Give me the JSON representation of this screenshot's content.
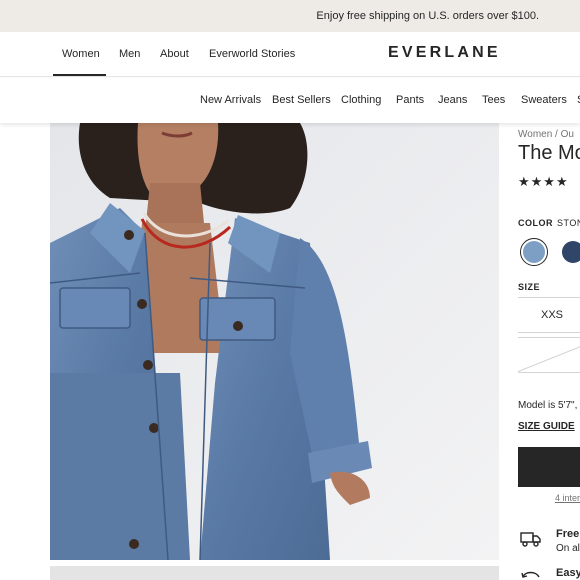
{
  "promo": {
    "text": "Enjoy free shipping on U.S. orders over $100."
  },
  "nav": {
    "links": [
      "Women",
      "Men",
      "About",
      "Everworld Stories"
    ],
    "logo": "EVERLANE"
  },
  "categories": [
    "New Arrivals",
    "Best Sellers",
    "Clothing",
    "Pants",
    "Jeans",
    "Tees",
    "Sweaters",
    "S"
  ],
  "product": {
    "breadcrumb": "Women  /  Ou",
    "title": "The Mo",
    "stars": "★★★★",
    "color_label": "COLOR",
    "color_value": "STONE",
    "swatch_colors": [
      "#7d9fc4",
      "#2f4669"
    ],
    "size_label": "SIZE",
    "size_option": "XXS",
    "model_note": "Model is 5'7\",",
    "size_guide": "SIZE GUIDE",
    "installments": "4 inter",
    "shipping_title": "Free",
    "shipping_sub": "On all",
    "returns_title": "Easy"
  },
  "colors": {
    "promo_bg": "#eeebe7",
    "text": "#262626",
    "button": "#262626"
  }
}
